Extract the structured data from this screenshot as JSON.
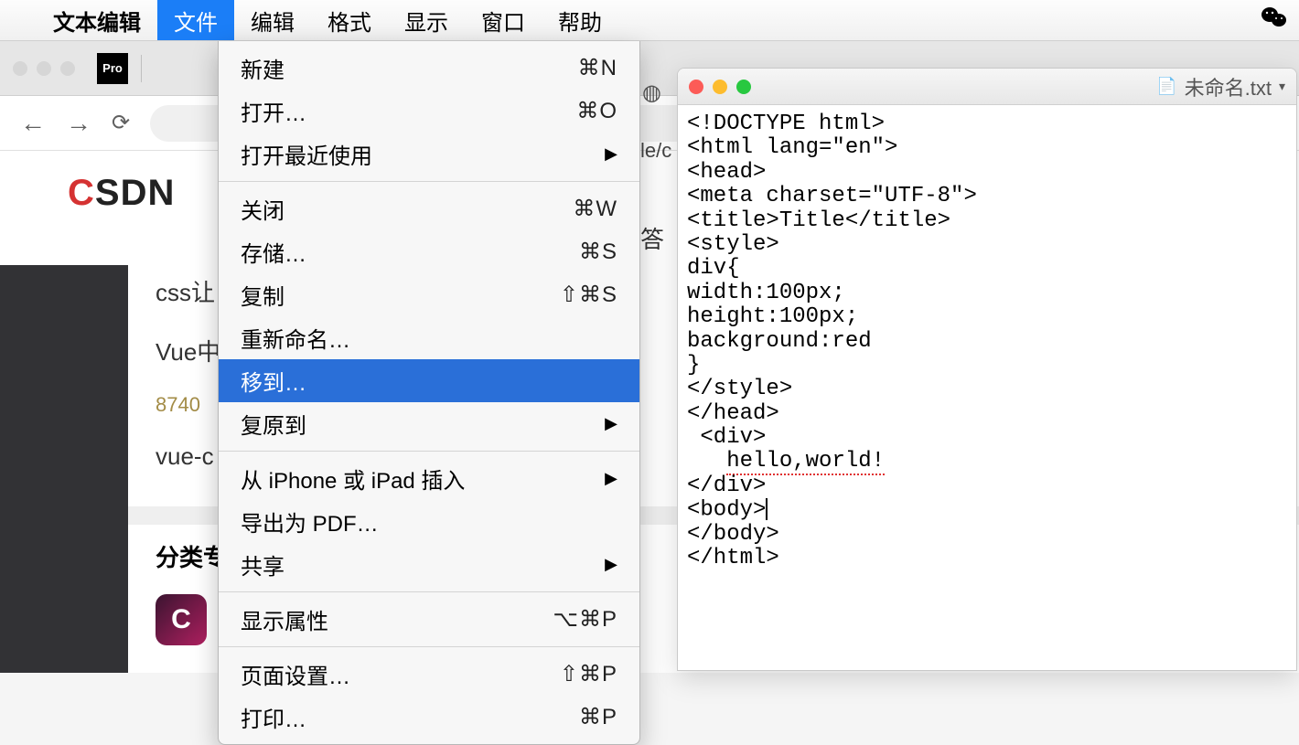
{
  "menubar": {
    "app_name": "文本编辑",
    "items": [
      "文件",
      "编辑",
      "格式",
      "显示",
      "窗口",
      "帮助"
    ],
    "active_index": 0
  },
  "dropdown": {
    "groups": [
      [
        {
          "label": "新建",
          "shortcut": "⌘N"
        },
        {
          "label": "打开…",
          "shortcut": "⌘O"
        },
        {
          "label": "打开最近使用",
          "submenu": true
        }
      ],
      [
        {
          "label": "关闭",
          "shortcut": "⌘W"
        },
        {
          "label": "存储…",
          "shortcut": "⌘S"
        },
        {
          "label": "复制",
          "shortcut": "⇧⌘S"
        },
        {
          "label": "重新命名…"
        },
        {
          "label": "移到…",
          "highlighted": true
        },
        {
          "label": "复原到",
          "submenu": true
        }
      ],
      [
        {
          "label": "从 iPhone 或 iPad 插入",
          "submenu": true
        },
        {
          "label": "导出为 PDF…"
        },
        {
          "label": "共享",
          "submenu": true
        }
      ],
      [
        {
          "label": "显示属性",
          "shortcut": "⌥⌘P"
        }
      ],
      [
        {
          "label": "页面设置…",
          "shortcut": "⇧⌘P"
        },
        {
          "label": "打印…",
          "shortcut": "⌘P"
        }
      ]
    ]
  },
  "browser": {
    "pro_badge": "Pro",
    "addr_fragment": "le/c",
    "logo_c": "C",
    "logo_rest": "SDN",
    "links": {
      "l1": "css让",
      "l2": "Vue中",
      "num": "8740",
      "l3": "vue-c"
    },
    "category": "分类专",
    "cat_letter": "C",
    "answer_fragment": "答"
  },
  "textedit": {
    "title": "未命名.txt",
    "content_lines": [
      "<!DOCTYPE html>",
      "<html lang=\"en\">",
      "<head>",
      "<meta charset=\"UTF-8\">",
      "<title>Title</title>",
      "<style>",
      "div{",
      "width:100px;",
      "height:100px;",
      "background:red",
      "}",
      "</style>",
      "</head>",
      " <div>",
      "   hello,world!",
      "</div>",
      "<body>",
      "</body>",
      "</html>"
    ],
    "spell_error_line_index": 14,
    "cursor_after_line_index": 16
  }
}
